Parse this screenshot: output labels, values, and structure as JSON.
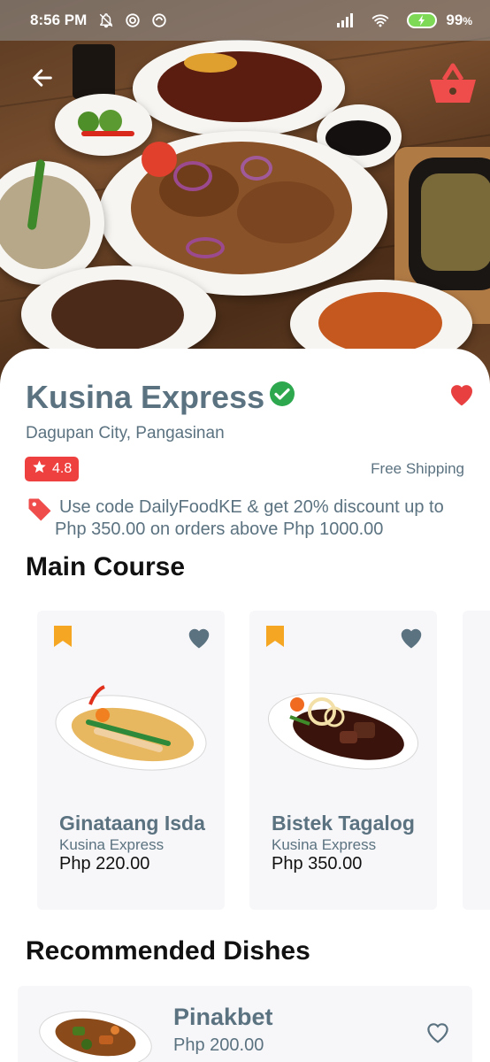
{
  "status_bar": {
    "time": "8:56 PM",
    "battery_percent": "99",
    "battery_suffix": "%",
    "icons": [
      "bell-off-icon",
      "app-notification-icon",
      "app-notification-icon",
      "signal-icon",
      "wifi-icon",
      "battery-charging-icon"
    ]
  },
  "header": {
    "back_icon": "arrow-left-icon",
    "cart_icon": "basket-icon",
    "cart_icon_color": "#ef4c4c"
  },
  "restaurant": {
    "name": "Kusina Express",
    "verified_icon": "check-circle-icon",
    "verified_color": "#2ea84f",
    "favorite_icon": "heart-filled-icon",
    "favorite_color": "#e84040",
    "location": "Dagupan City, Pangasinan",
    "rating": "4.8",
    "rating_color": "#ef4040",
    "shipping": "Free Shipping",
    "promo_icon": "tag-icon",
    "promo": "Use code DailyFoodKE & get 20% discount up to Php 350.00 on orders above Php 1000.00"
  },
  "main_course": {
    "title": "Main Course",
    "items": [
      {
        "name": "Ginataang Isda",
        "restaurant": "Kusina Express",
        "price": "Php 220.00"
      },
      {
        "name": "Bistek Tagalog",
        "restaurant": "Kusina Express",
        "price": "Php 350.00"
      }
    ],
    "bookmark_color": "#f5a623",
    "heart_color": "#5b7280"
  },
  "recommended": {
    "title": "Recommended Dishes",
    "items": [
      {
        "name": "Pinakbet",
        "price": "Php 200.00"
      }
    ]
  },
  "colors": {
    "text_primary": "#5b7280",
    "text_dark": "#111111",
    "card_bg": "#f7f7f9"
  }
}
